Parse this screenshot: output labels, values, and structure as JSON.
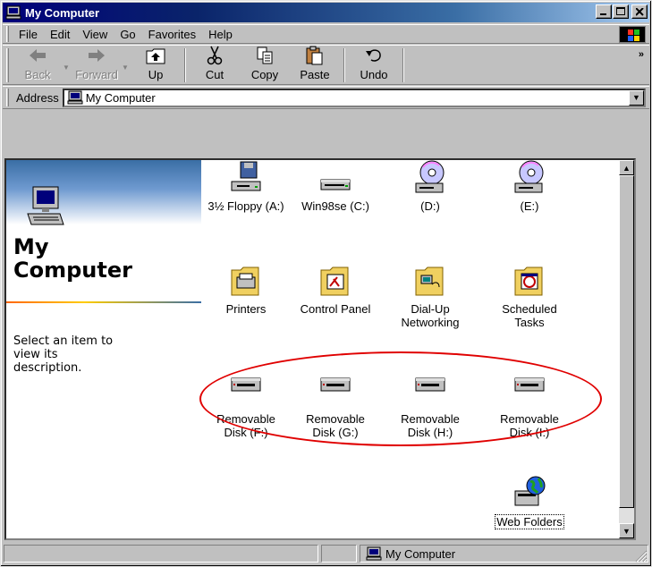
{
  "window": {
    "title": "My Computer"
  },
  "menu": [
    "File",
    "Edit",
    "View",
    "Go",
    "Favorites",
    "Help"
  ],
  "toolbar": {
    "back": "Back",
    "forward": "Forward",
    "up": "Up",
    "cut": "Cut",
    "copy": "Copy",
    "paste": "Paste",
    "undo": "Undo",
    "more": "»"
  },
  "address": {
    "label": "Address",
    "value": "My Computer"
  },
  "left_panel": {
    "title_line1": "My",
    "title_line2": "Computer",
    "description_line1": "Select an item to",
    "description_line2": "view its",
    "description_line3": "description."
  },
  "items": [
    {
      "line1": "3½ Floppy (A:)",
      "line2": "",
      "icon": "floppy-drive-icon"
    },
    {
      "line1": "Win98se (C:)",
      "line2": "",
      "icon": "hard-drive-icon"
    },
    {
      "line1": "(D:)",
      "line2": "",
      "icon": "cd-drive-icon"
    },
    {
      "line1": "(E:)",
      "line2": "",
      "icon": "cd-drive-icon"
    },
    {
      "line1": "Printers",
      "line2": "",
      "icon": "printers-folder-icon"
    },
    {
      "line1": "Control Panel",
      "line2": "",
      "icon": "control-panel-folder-icon"
    },
    {
      "line1": "Dial-Up",
      "line2": "Networking",
      "icon": "dialup-folder-icon"
    },
    {
      "line1": "Scheduled",
      "line2": "Tasks",
      "icon": "scheduled-tasks-folder-icon"
    },
    {
      "line1": "Removable",
      "line2": "Disk (F:)",
      "icon": "removable-disk-icon"
    },
    {
      "line1": "Removable",
      "line2": "Disk (G:)",
      "icon": "removable-disk-icon"
    },
    {
      "line1": "Removable",
      "line2": "Disk (H:)",
      "icon": "removable-disk-icon"
    },
    {
      "line1": "Removable",
      "line2": "Disk (I:)",
      "icon": "removable-disk-icon"
    },
    {
      "line1": "Web Folders",
      "line2": "",
      "icon": "web-folders-icon"
    }
  ],
  "status": {
    "location": "My Computer"
  },
  "colors": {
    "title_bar": "#0a246a",
    "annotation": "#e00000",
    "window_face": "#c0c0c0"
  }
}
